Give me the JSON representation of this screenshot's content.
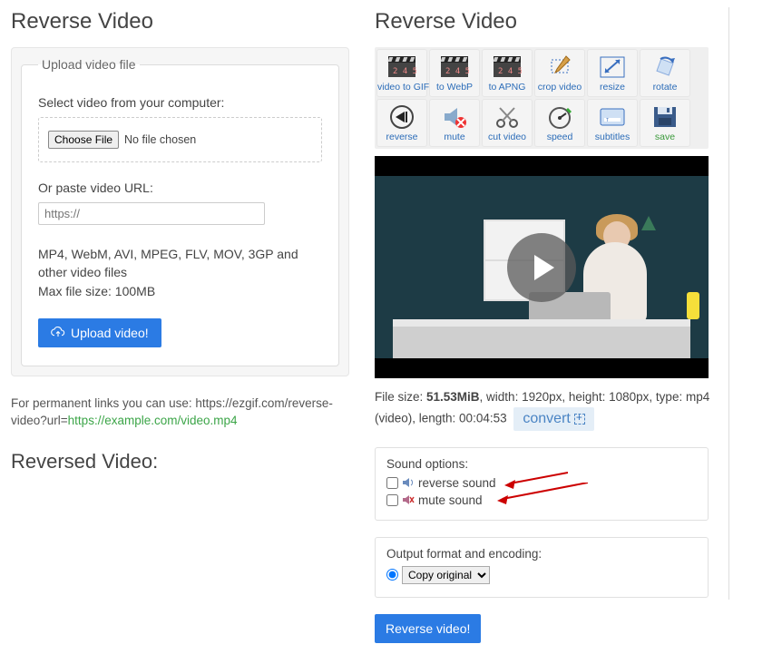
{
  "left": {
    "title": "Reverse Video",
    "fieldset_legend": "Upload video file",
    "select_label": "Select video from your computer:",
    "choose_file_btn": "Choose File",
    "file_status": "No file chosen",
    "or_paste_label": "Or paste video URL:",
    "url_placeholder": "https://",
    "formats_text": "MP4, WebM, AVI, MPEG, FLV, MOV, 3GP and other video files",
    "maxsize_text": "Max file size: 100MB",
    "upload_btn": "Upload video!",
    "permlink_prefix": "For permanent links you can use: https://ezgif.com/reverse-video?url=",
    "permlink_example": "https://example.com/video.mp4",
    "reversed_title": "Reversed Video:"
  },
  "right": {
    "title": "Reverse Video",
    "tools": [
      {
        "label": "video to GIF",
        "icon": "clapper"
      },
      {
        "label": "to WebP",
        "icon": "clapper"
      },
      {
        "label": "to APNG",
        "icon": "clapper"
      },
      {
        "label": "crop video",
        "icon": "crop"
      },
      {
        "label": "resize",
        "icon": "resize"
      },
      {
        "label": "rotate",
        "icon": "rotate"
      },
      {
        "label": "reverse",
        "icon": "reverse"
      },
      {
        "label": "mute",
        "icon": "mute"
      },
      {
        "label": "cut video",
        "icon": "scissors"
      },
      {
        "label": "speed",
        "icon": "speed"
      },
      {
        "label": "subtitles",
        "icon": "subtitles"
      },
      {
        "label": "save",
        "icon": "save",
        "class": "save"
      }
    ],
    "meta_prefix": "File size: ",
    "file_size": "51.53MiB",
    "meta_middle1": ", width: 1920px, height: 1080px, type: mp4 (video), length: 00:04:53",
    "convert_label": "convert",
    "sound_title": "Sound options:",
    "reverse_sound_label": "reverse sound",
    "mute_sound_label": "mute sound",
    "output_title": "Output format and encoding:",
    "output_select": "Copy original",
    "reverse_btn": "Reverse video!"
  }
}
